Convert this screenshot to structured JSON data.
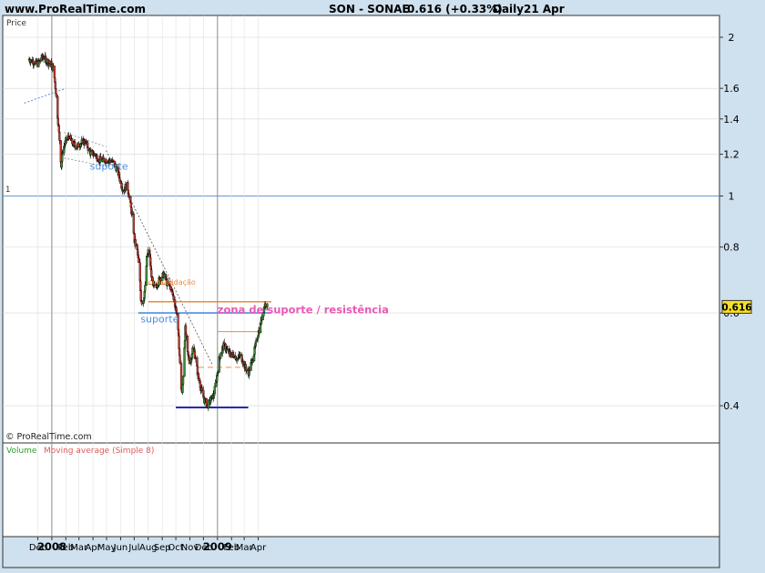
{
  "header": {
    "site": "www.ProRealTime.com",
    "instrument": "SON - SONAE",
    "quote": "0.616 (+0.33%)",
    "period": "Daily",
    "date": "21 Apr"
  },
  "labels": {
    "price": "Price",
    "copyright": "© ProRealTime.com",
    "one_marker": "1",
    "current_price": "0.616",
    "volume": "Volume",
    "moving_average": "Moving average (Simple 8)"
  },
  "colors": {
    "background": "#cfe0ee",
    "panel": "#ffffff",
    "up_candle": "#3a8a3a",
    "down_candle": "#c0392b",
    "support": "#4a8ee8",
    "orange": "#f08a3a",
    "navy": "#2a2ab0",
    "pink": "#e85ab4",
    "volume_label": "#2e9e2e",
    "ma_label": "#e05a5a"
  },
  "chart_data": {
    "type": "candlestick",
    "title": "SON - SONAE",
    "ylabel": "Price",
    "y_scale": "log",
    "ylim": [
      0.34,
      2.2
    ],
    "y_ticks": [
      "2",
      "1.6",
      "1.4",
      "1.2",
      "1",
      "0.8",
      "0.6",
      "0.4"
    ],
    "x_tick_labels": [
      "Dec",
      "2008",
      "Feb",
      "Mar",
      "Apr",
      "May",
      "Jun",
      "Jul",
      "Aug",
      "Sep",
      "Oct",
      "Nov",
      "Dec",
      "2009",
      "Feb",
      "Mar",
      "Apr"
    ],
    "x_ticks": [
      {
        "label": "Dec",
        "date": "2007-12-01"
      },
      {
        "label": "2008",
        "date": "2008-01-01"
      },
      {
        "label": "Feb",
        "date": "2008-02-01"
      },
      {
        "label": "Mar",
        "date": "2008-03-01"
      },
      {
        "label": "Apr",
        "date": "2008-04-01"
      },
      {
        "label": "May",
        "date": "2008-05-01"
      },
      {
        "label": "Jun",
        "date": "2008-06-01"
      },
      {
        "label": "Jul",
        "date": "2008-07-01"
      },
      {
        "label": "Aug",
        "date": "2008-08-01"
      },
      {
        "label": "Sep",
        "date": "2008-09-01"
      },
      {
        "label": "Oct",
        "date": "2008-10-01"
      },
      {
        "label": "Nov",
        "date": "2008-11-01"
      },
      {
        "label": "Dec",
        "date": "2008-12-01"
      },
      {
        "label": "2009",
        "date": "2009-01-01"
      },
      {
        "label": "Feb",
        "date": "2009-02-01"
      },
      {
        "label": "Mar",
        "date": "2009-03-01"
      },
      {
        "label": "Apr",
        "date": "2009-04-01"
      }
    ],
    "close_path": [
      [
        "2007-11-10",
        1.82
      ],
      [
        "2007-11-20",
        1.8
      ],
      [
        "2007-12-01",
        1.78
      ],
      [
        "2007-12-12",
        1.84
      ],
      [
        "2007-12-22",
        1.8
      ],
      [
        "2008-01-01",
        1.77
      ],
      [
        "2008-01-05",
        1.74
      ],
      [
        "2008-01-10",
        1.58
      ],
      [
        "2008-01-14",
        1.42
      ],
      [
        "2008-01-18",
        1.28
      ],
      [
        "2008-01-22",
        1.14
      ],
      [
        "2008-01-25",
        1.22
      ],
      [
        "2008-02-01",
        1.27
      ],
      [
        "2008-02-08",
        1.3
      ],
      [
        "2008-02-15",
        1.26
      ],
      [
        "2008-02-25",
        1.24
      ],
      [
        "2008-03-05",
        1.26
      ],
      [
        "2008-03-15",
        1.27
      ],
      [
        "2008-03-25",
        1.21
      ],
      [
        "2008-04-05",
        1.2
      ],
      [
        "2008-04-15",
        1.17
      ],
      [
        "2008-04-25",
        1.17
      ],
      [
        "2008-05-05",
        1.17
      ],
      [
        "2008-05-15",
        1.16
      ],
      [
        "2008-05-25",
        1.12
      ],
      [
        "2008-06-01",
        1.06
      ],
      [
        "2008-06-08",
        1.02
      ],
      [
        "2008-06-15",
        1.06
      ],
      [
        "2008-06-22",
        0.97
      ],
      [
        "2008-06-28",
        0.9
      ],
      [
        "2008-07-02",
        0.82
      ],
      [
        "2008-07-07",
        0.8
      ],
      [
        "2008-07-12",
        0.73
      ],
      [
        "2008-07-16",
        0.64
      ],
      [
        "2008-07-20",
        0.62
      ],
      [
        "2008-07-25",
        0.67
      ],
      [
        "2008-07-29",
        0.76
      ],
      [
        "2008-08-03",
        0.8
      ],
      [
        "2008-08-07",
        0.72
      ],
      [
        "2008-08-12",
        0.67
      ],
      [
        "2008-08-20",
        0.68
      ],
      [
        "2008-08-28",
        0.7
      ],
      [
        "2008-09-05",
        0.71
      ],
      [
        "2008-09-12",
        0.68
      ],
      [
        "2008-09-20",
        0.67
      ],
      [
        "2008-09-28",
        0.63
      ],
      [
        "2008-10-03",
        0.6
      ],
      [
        "2008-10-08",
        0.52
      ],
      [
        "2008-10-12",
        0.44
      ],
      [
        "2008-10-15",
        0.42
      ],
      [
        "2008-10-19",
        0.5
      ],
      [
        "2008-10-22",
        0.56
      ],
      [
        "2008-10-27",
        0.5
      ],
      [
        "2008-11-02",
        0.48
      ],
      [
        "2008-11-08",
        0.52
      ],
      [
        "2008-11-14",
        0.49
      ],
      [
        "2008-11-20",
        0.45
      ],
      [
        "2008-11-26",
        0.43
      ],
      [
        "2008-12-03",
        0.41
      ],
      [
        "2008-12-10",
        0.4
      ],
      [
        "2008-12-17",
        0.41
      ],
      [
        "2008-12-24",
        0.42
      ],
      [
        "2008-12-30",
        0.45
      ],
      [
        "2009-01-05",
        0.49
      ],
      [
        "2009-01-10",
        0.51
      ],
      [
        "2009-01-15",
        0.52
      ],
      [
        "2009-01-22",
        0.51
      ],
      [
        "2009-01-30",
        0.5
      ],
      [
        "2009-02-07",
        0.5
      ],
      [
        "2009-02-14",
        0.49
      ],
      [
        "2009-02-21",
        0.5
      ],
      [
        "2009-02-28",
        0.48
      ],
      [
        "2009-03-05",
        0.47
      ],
      [
        "2009-03-10",
        0.46
      ],
      [
        "2009-03-16",
        0.48
      ],
      [
        "2009-03-22",
        0.5
      ],
      [
        "2009-03-28",
        0.53
      ],
      [
        "2009-04-01",
        0.55
      ],
      [
        "2009-04-06",
        0.57
      ],
      [
        "2009-04-11",
        0.6
      ],
      [
        "2009-04-15",
        0.62
      ],
      [
        "2009-04-19",
        0.63
      ],
      [
        "2009-04-21",
        0.616
      ]
    ],
    "lines": [
      {
        "role": "support-dotted",
        "from": [
          "2007-11-01",
          1.5
        ],
        "to": [
          "2008-02-01",
          1.6
        ]
      },
      {
        "role": "channel-top",
        "from": [
          "2008-01-28",
          1.32
        ],
        "to": [
          "2008-04-30",
          1.24
        ]
      },
      {
        "role": "channel-bottom",
        "from": [
          "2008-01-28",
          1.18
        ],
        "to": [
          "2008-04-25",
          1.14
        ]
      },
      {
        "role": "downtrend",
        "from": [
          "2008-04-30",
          1.22
        ],
        "to": [
          "2008-12-20",
          0.48
        ]
      },
      {
        "role": "level-0.6",
        "from": [
          "2008-07-10",
          0.6
        ],
        "to": [
          "2009-04-30",
          0.6
        ]
      },
      {
        "role": "level-0.63",
        "from": [
          "2008-08-01",
          0.63
        ],
        "to": [
          "2009-04-30",
          0.63
        ]
      },
      {
        "role": "level-0.68",
        "from": [
          "2008-08-01",
          0.68
        ],
        "to": [
          "2008-09-25",
          0.68
        ]
      },
      {
        "role": "level-0.553",
        "from": [
          "2009-01-01",
          0.553
        ],
        "to": [
          "2009-04-10",
          0.553
        ]
      },
      {
        "role": "level-0.473",
        "from": [
          "2008-11-20",
          0.473
        ],
        "to": [
          "2009-02-25",
          0.473
        ]
      },
      {
        "role": "level-0.397",
        "from": [
          "2008-10-01",
          0.397
        ],
        "to": [
          "2009-03-10",
          0.397
        ]
      }
    ],
    "annotations": [
      {
        "id": "suporte_1",
        "text": "suporte",
        "at": [
          "2008-03-25",
          1.14
        ]
      },
      {
        "id": "consolidacao",
        "text": "consolidação",
        "at": [
          "2008-08-01",
          0.69
        ]
      },
      {
        "id": "suporte_2",
        "text": "suporte",
        "at": [
          "2008-07-15",
          0.585
        ]
      },
      {
        "id": "zona",
        "text": "zona de suporte / resistência",
        "at": [
          "2009-01-01",
          0.608
        ]
      }
    ]
  }
}
